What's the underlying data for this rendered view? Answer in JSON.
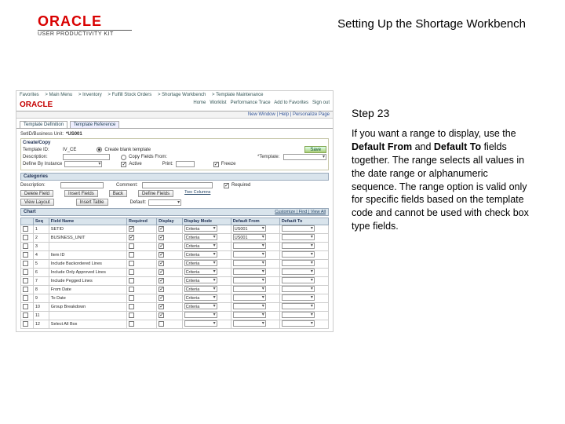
{
  "logo": {
    "brand": "ORACLE",
    "subline": "USER PRODUCTIVITY KIT"
  },
  "title": "Setting Up the Shortage Workbench",
  "step": "Step 23",
  "body_segments": [
    {
      "t": "If you want a range to display, use the ",
      "b": false
    },
    {
      "t": "Default From",
      "b": true
    },
    {
      "t": " and ",
      "b": false
    },
    {
      "t": "Default To",
      "b": true
    },
    {
      "t": " fields together. The range selects all values in the date range or alphanumeric sequence. The range option is valid only for specific fields based on the template code and cannot be used with check box type fields.",
      "b": false
    }
  ],
  "shot": {
    "topnav": [
      "Favorites",
      "Main Menu",
      "Inventory",
      "Fulfill Stock Orders",
      "Shortage Workbench",
      "Template Maintenance"
    ],
    "rightlinks": [
      "Home",
      "Worklist",
      "Performance Trace",
      "Add to Favorites",
      "Sign out"
    ],
    "crumbs": "New Window | Help | Personalize Page",
    "tabs": [
      "Template Definition",
      "Template Reference"
    ],
    "setid_label": "SetID/Business Unit:",
    "setid_value": "*US001",
    "create_copy": "Create/Copy",
    "radio1": "Create blank template",
    "radio2": "Copy Fields From:",
    "save": "Save",
    "template_id_label": "Template ID:",
    "template_id_value": "IV_CE",
    "template_label": "*Template:",
    "desc_label": "Description:",
    "desc_lbl2": "Description:",
    "comment_lbl": "Comment:",
    "default_lbl": "Default:",
    "active_lbl": "Active",
    "print_lbl": "Print:",
    "freeze_lbl": "Freeze",
    "cat_bar": "Categories",
    "instance_lbl": "Define By Instance",
    "cat_btns": [
      "Delete Field",
      "Insert Fields",
      "Back",
      "Define Fields",
      "Two Columns"
    ],
    "view_lbl": "View Layout",
    "insert_lbl": "Insert Table",
    "required_ck": "Required",
    "table_headers": [
      "",
      "Seq",
      "Field Name",
      "Required",
      "Display",
      "Display Mode",
      "Default From",
      "Default To"
    ],
    "rows": [
      {
        "seq": "1",
        "name": "SETID",
        "req": true,
        "disp": true,
        "mode": "Criteria",
        "from": "US001",
        "to": ""
      },
      {
        "seq": "2",
        "name": "BUSINESS_UNIT",
        "req": true,
        "disp": true,
        "mode": "Criteria",
        "from": "US001",
        "to": ""
      },
      {
        "seq": "3",
        "name": "",
        "req": false,
        "disp": true,
        "mode": "Criteria",
        "from": "",
        "to": ""
      },
      {
        "seq": "4",
        "name": "Item ID",
        "req": false,
        "disp": true,
        "mode": "Criteria",
        "from": "",
        "to": ""
      },
      {
        "seq": "5",
        "name": "Include Backordered Lines",
        "req": false,
        "disp": true,
        "mode": "Criteria",
        "from": "",
        "to": ""
      },
      {
        "seq": "6",
        "name": "Include Only Approved Lines",
        "req": false,
        "disp": true,
        "mode": "Criteria",
        "from": "",
        "to": ""
      },
      {
        "seq": "7",
        "name": "Include Pegged Lines",
        "req": false,
        "disp": true,
        "mode": "Criteria",
        "from": "",
        "to": ""
      },
      {
        "seq": "8",
        "name": "From Date",
        "req": false,
        "disp": true,
        "mode": "Criteria",
        "from": "",
        "to": ""
      },
      {
        "seq": "9",
        "name": "To Date",
        "req": false,
        "disp": true,
        "mode": "Criteria",
        "from": "",
        "to": ""
      },
      {
        "seq": "10",
        "name": "Group Breakdown",
        "req": false,
        "disp": true,
        "mode": "Criteria",
        "from": "",
        "to": ""
      },
      {
        "seq": "11",
        "name": "",
        "req": false,
        "disp": true,
        "mode": "",
        "from": "",
        "to": ""
      },
      {
        "seq": "12",
        "name": "Select All Box",
        "req": false,
        "disp": false,
        "mode": "",
        "from": "",
        "to": ""
      }
    ],
    "chart_hdr": [
      "Chart",
      "Customize | Find | View All"
    ]
  }
}
